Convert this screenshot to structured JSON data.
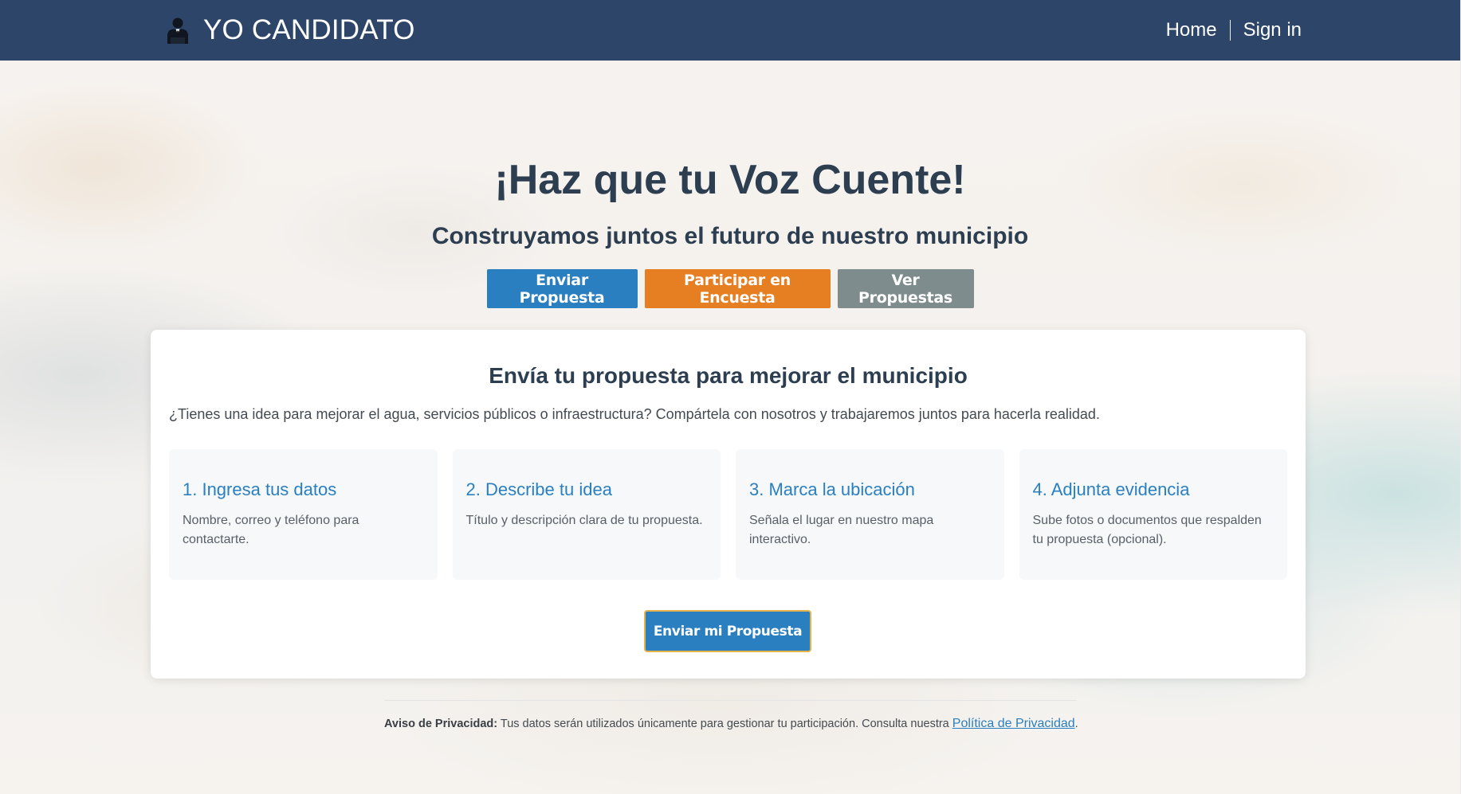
{
  "navbar": {
    "brand_icon": "candidate-person-icon",
    "brand_text": "YO CANDIDATO",
    "links": [
      {
        "label": "Home"
      },
      {
        "label": "Sign in"
      }
    ]
  },
  "hero": {
    "title": "¡Haz que tu Voz Cuente!",
    "subtitle": "Construyamos juntos el futuro de nuestro municipio",
    "buttons": [
      {
        "label": "Enviar Propuesta",
        "color": "#2a7fc0"
      },
      {
        "label": "Participar en Encuesta",
        "color": "#e67e22"
      },
      {
        "label": "Ver Propuestas",
        "color": "#7f8c8d"
      }
    ]
  },
  "proposal_card": {
    "title": "Envía tu propuesta para mejorar el municipio",
    "description": "¿Tienes una idea para mejorar el agua, servicios públicos o infraestructura? Compártela con nosotros y trabajaremos juntos para hacerla realidad.",
    "steps": [
      {
        "title": "1. Ingresa tus datos",
        "text": "Nombre, correo y teléfono para contactarte."
      },
      {
        "title": "2. Describe tu idea",
        "text": "Título y descripción clara de tu propuesta."
      },
      {
        "title": "3. Marca la ubicación",
        "text": "Señala el lugar en nuestro mapa interactivo."
      },
      {
        "title": "4. Adjunta evidencia",
        "text": "Sube fotos o documentos que respalden tu propuesta (opcional)."
      }
    ],
    "cta_label": "Enviar mi Propuesta"
  },
  "footer": {
    "privacy_label": "Aviso de Privacidad:",
    "privacy_text": " Tus datos serán utilizados únicamente para gestionar tu participación. Consulta nuestra ",
    "privacy_link": "Política de Privacidad",
    "privacy_end": "."
  },
  "colors": {
    "navbar_bg": "#2d4569",
    "heading": "#2c3e50",
    "accent_blue": "#2a7fc0",
    "accent_orange": "#e67e22",
    "accent_gray": "#7f8c8d"
  }
}
